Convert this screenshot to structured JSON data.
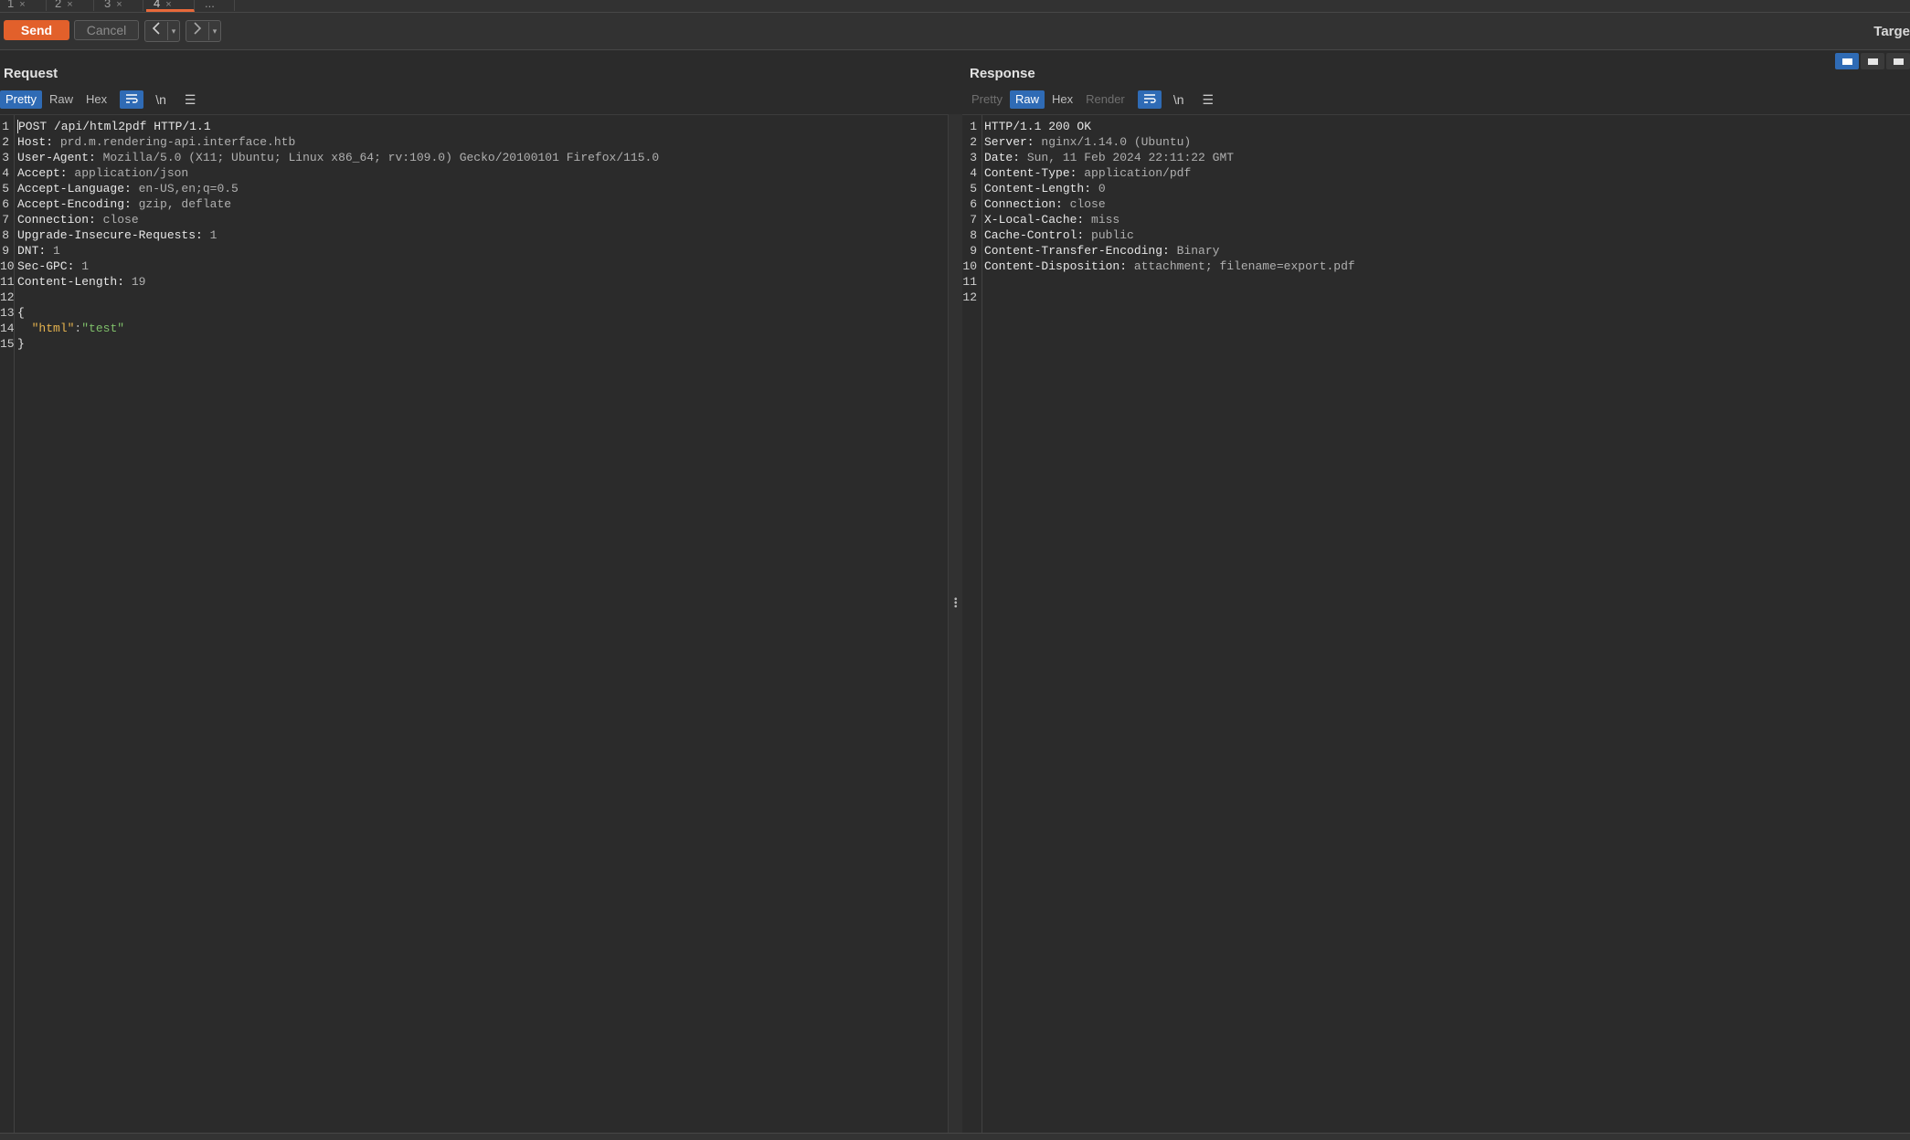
{
  "tabs": [
    {
      "label": "1",
      "close": "×"
    },
    {
      "label": "2",
      "close": "×"
    },
    {
      "label": "3",
      "close": "×"
    },
    {
      "label": "4",
      "close": "×"
    },
    {
      "label": "..."
    }
  ],
  "toolbar": {
    "send_label": "Send",
    "cancel_label": "Cancel",
    "back_icon": "chevron-left-icon",
    "forward_icon": "chevron-right-icon",
    "target_label": "Targe"
  },
  "colors": {
    "accent": "#e2602b",
    "selection": "#2f6bb5",
    "background": "#2b2b2b"
  },
  "request": {
    "title": "Request",
    "view_tabs": [
      "Pretty",
      "Raw",
      "Hex"
    ],
    "active_view": "Pretty",
    "lines": [
      {
        "n": "1",
        "k": "POST /api/html2pdf HTTP/1.1",
        "v": ""
      },
      {
        "n": "2",
        "k": "Host:",
        "v": " prd.m.rendering-api.interface.htb"
      },
      {
        "n": "3",
        "k": "User-Agent:",
        "v": " Mozilla/5.0 (X11; Ubuntu; Linux x86_64; rv:109.0) Gecko/20100101 Firefox/115.0"
      },
      {
        "n": "4",
        "k": "Accept:",
        "v": " application/json"
      },
      {
        "n": "5",
        "k": "Accept-Language:",
        "v": " en-US,en;q=0.5"
      },
      {
        "n": "6",
        "k": "Accept-Encoding:",
        "v": " gzip, deflate"
      },
      {
        "n": "7",
        "k": "Connection:",
        "v": " close"
      },
      {
        "n": "8",
        "k": "Upgrade-Insecure-Requests:",
        "v": " 1"
      },
      {
        "n": "9",
        "k": "DNT:",
        "v": " 1"
      },
      {
        "n": "10",
        "k": "Sec-GPC:",
        "v": " 1"
      },
      {
        "n": "11",
        "k": "Content-Length:",
        "v": " 19"
      },
      {
        "n": "12",
        "k": "",
        "v": ""
      },
      {
        "n": "13",
        "k": "{",
        "v": ""
      },
      {
        "n": "14",
        "k": "",
        "v": "",
        "json_key": "\"html\"",
        "json_sep": ":",
        "json_val": "\"test\""
      },
      {
        "n": "15",
        "k": "}",
        "v": ""
      }
    ]
  },
  "response": {
    "title": "Response",
    "view_tabs": [
      "Pretty",
      "Raw",
      "Hex",
      "Render"
    ],
    "active_view": "Raw",
    "lines": [
      {
        "n": "1",
        "k": "HTTP/1.1 200 OK",
        "v": ""
      },
      {
        "n": "2",
        "k": "Server:",
        "v": " nginx/1.14.0 (Ubuntu)"
      },
      {
        "n": "3",
        "k": "Date:",
        "v": " Sun, 11 Feb 2024 22:11:22 GMT"
      },
      {
        "n": "4",
        "k": "Content-Type:",
        "v": " application/pdf"
      },
      {
        "n": "5",
        "k": "Content-Length:",
        "v": " 0"
      },
      {
        "n": "6",
        "k": "Connection:",
        "v": " close"
      },
      {
        "n": "7",
        "k": "X-Local-Cache:",
        "v": " miss"
      },
      {
        "n": "8",
        "k": "Cache-Control:",
        "v": " public"
      },
      {
        "n": "9",
        "k": "Content-Transfer-Encoding:",
        "v": " Binary"
      },
      {
        "n": "10",
        "k": "Content-Disposition:",
        "v": " attachment; filename=export.pdf"
      },
      {
        "n": "11",
        "k": "",
        "v": ""
      },
      {
        "n": "12",
        "k": "",
        "v": ""
      }
    ]
  }
}
